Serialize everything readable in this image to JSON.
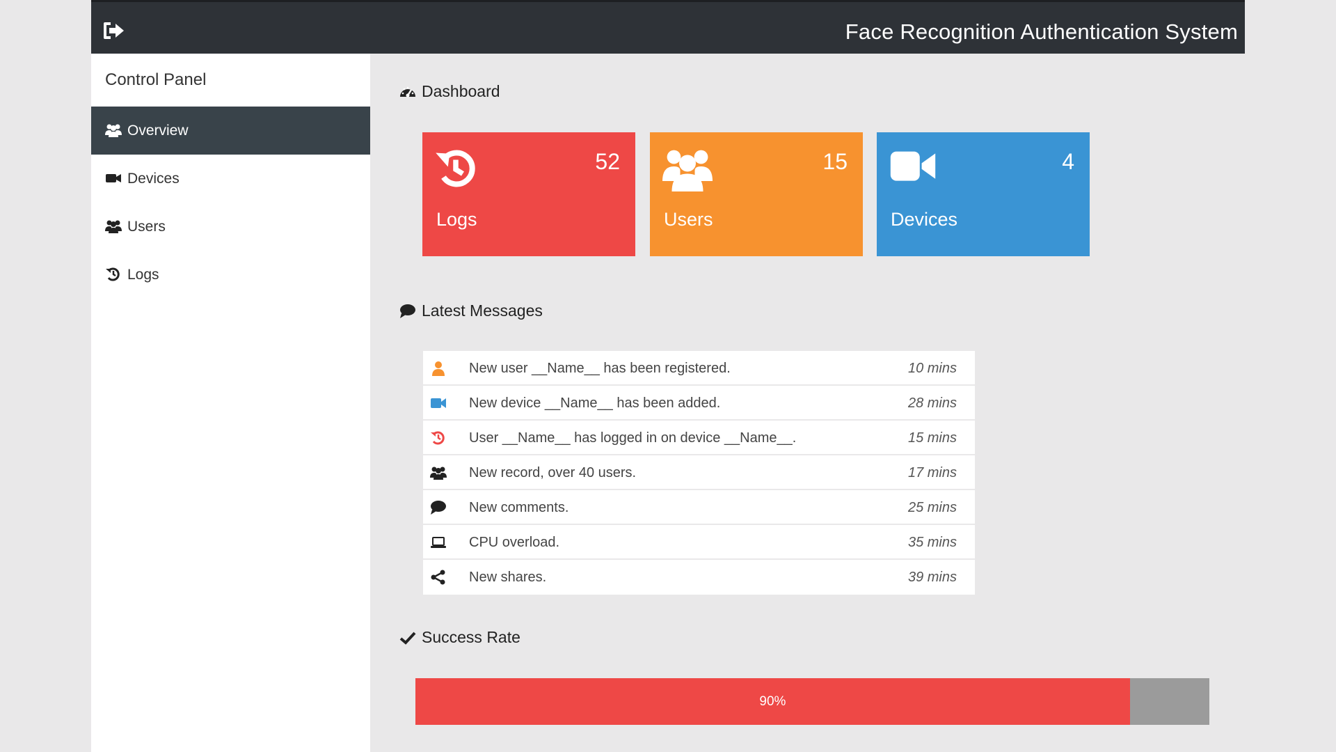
{
  "header": {
    "title": "Face Recognition Authentication System",
    "logout_icon": "sign-out-icon"
  },
  "sidebar": {
    "heading": "Control Panel",
    "items": [
      {
        "label": "Overview",
        "icon": "users-icon",
        "active": true
      },
      {
        "label": "Devices",
        "icon": "video-camera-icon",
        "active": false
      },
      {
        "label": "Users",
        "icon": "users-icon",
        "active": false
      },
      {
        "label": "Logs",
        "icon": "history-icon",
        "active": false
      }
    ]
  },
  "dashboard": {
    "title": "Dashboard",
    "icon": "dashboard-icon",
    "cards": [
      {
        "label": "Logs",
        "count": "52",
        "icon": "history-icon",
        "color": "#ee4846"
      },
      {
        "label": "Users",
        "count": "15",
        "icon": "users-icon",
        "color": "#f7922f"
      },
      {
        "label": "Devices",
        "count": "4",
        "icon": "video-camera-icon",
        "color": "#3a94d4"
      }
    ]
  },
  "messages": {
    "title": "Latest Messages",
    "icon": "comment-icon",
    "items": [
      {
        "text": "New user __Name__ has been registered.",
        "time": "10 mins",
        "icon": "user-icon",
        "icon_color": "#f7922f"
      },
      {
        "text": "New device __Name__ has been added.",
        "time": "28 mins",
        "icon": "video-camera-icon",
        "icon_color": "#3a94d4"
      },
      {
        "text": "User __Name__ has logged in on device __Name__.",
        "time": "15 mins",
        "icon": "history-icon",
        "icon_color": "#ee4846"
      },
      {
        "text": "New record, over 40 users.",
        "time": "17 mins",
        "icon": "users-icon",
        "icon_color": "#222222"
      },
      {
        "text": "New comments.",
        "time": "25 mins",
        "icon": "comment-icon",
        "icon_color": "#222222"
      },
      {
        "text": "CPU overload.",
        "time": "35 mins",
        "icon": "laptop-icon",
        "icon_color": "#222222"
      },
      {
        "text": "New shares.",
        "time": "39 mins",
        "icon": "share-icon",
        "icon_color": "#222222"
      }
    ]
  },
  "success_rate": {
    "title": "Success Rate",
    "icon": "check-icon",
    "value": 0.9,
    "label": "90%",
    "fill_color": "#ee4846",
    "track_color": "#9b9b9b"
  }
}
